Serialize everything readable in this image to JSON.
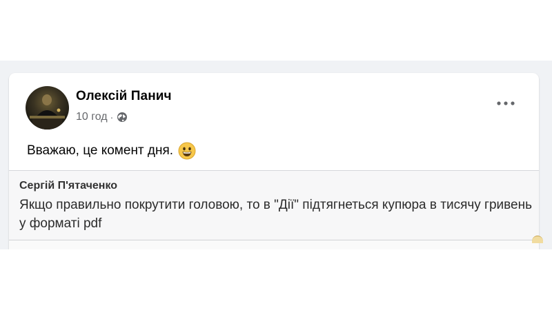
{
  "post": {
    "author_name": "Олексій Панич",
    "timestamp": "10 год",
    "separator": "·",
    "privacy_icon": "globe-icon",
    "more_icon": "more-options-icon",
    "text": "Вважаю, це комент дня.",
    "emoji_icon": "grinning-face-icon"
  },
  "quoted_comment": {
    "author_name": "Сергій П'ятаченко",
    "text": "Якщо правильно покрутити головою, то в \"Дії\" підтягнеться купюра в тисячу гривень у форматі pdf"
  },
  "colors": {
    "feed_background": "#f0f2f5",
    "card_background": "#ffffff",
    "name_text": "#050505",
    "secondary_text": "#65676b",
    "emoji_yellow": "#f7c74a"
  }
}
